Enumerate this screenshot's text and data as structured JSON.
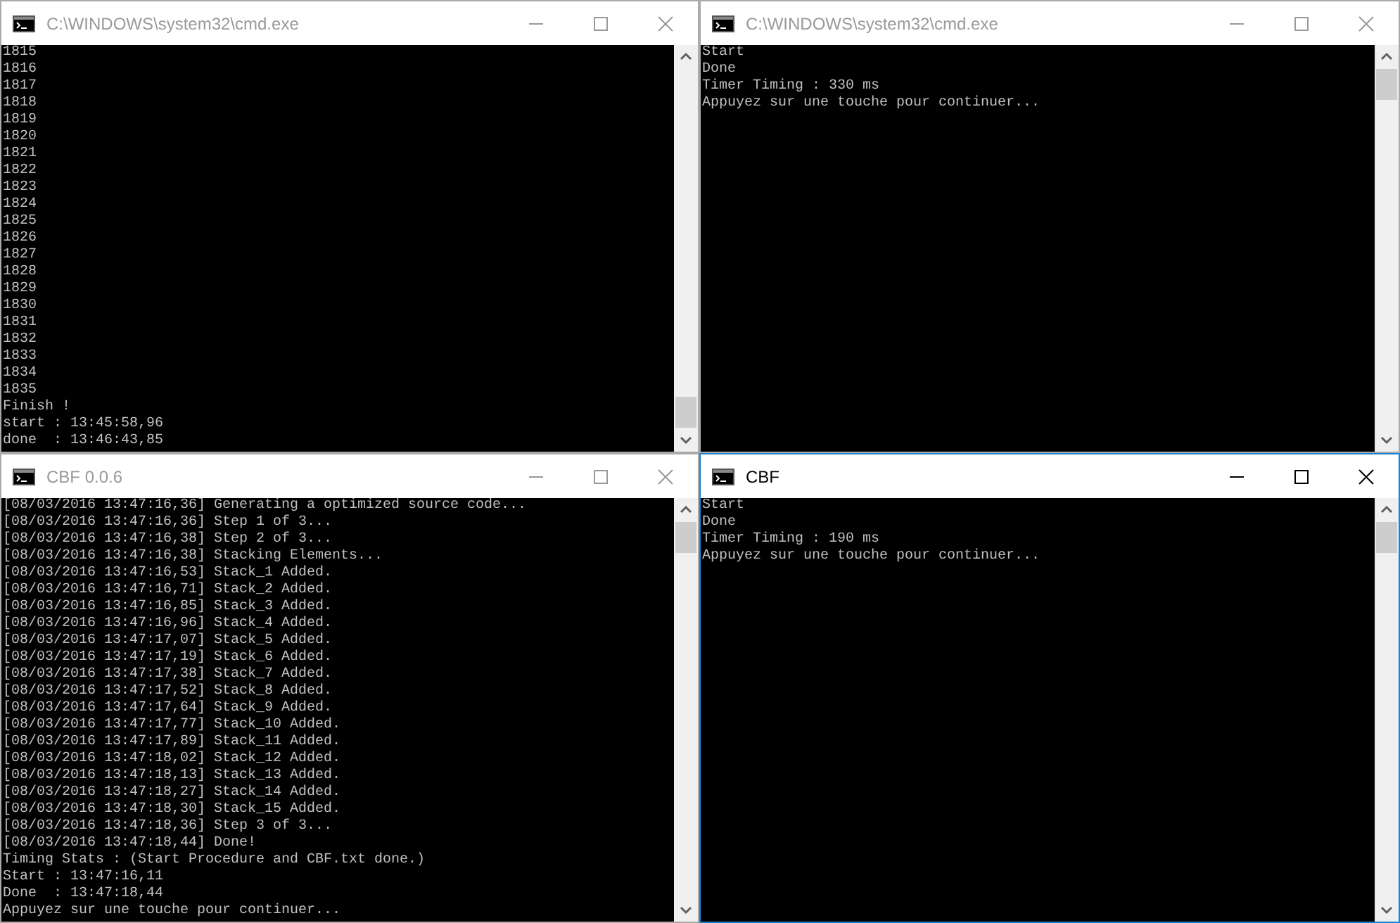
{
  "windows": [
    {
      "title": "C:\\WINDOWS\\system32\\cmd.exe",
      "active": false,
      "scrolled_to_bottom": true,
      "lines": [
        "1815",
        "1816",
        "1817",
        "1818",
        "1819",
        "1820",
        "1821",
        "1822",
        "1823",
        "1824",
        "1825",
        "1826",
        "1827",
        "1828",
        "1829",
        "1830",
        "1831",
        "1832",
        "1833",
        "1834",
        "1835",
        "Finish !",
        "start : 13:45:58,96",
        "done  : 13:46:43,85"
      ]
    },
    {
      "title": "C:\\WINDOWS\\system32\\cmd.exe",
      "active": false,
      "scrolled_to_bottom": false,
      "lines": [
        "Start",
        "Done",
        "Timer Timing : 330 ms",
        "Appuyez sur une touche pour continuer..."
      ]
    },
    {
      "title": "CBF 0.0.6",
      "active": false,
      "scrolled_to_bottom": false,
      "lines": [
        "[08/03/2016 13:47:16,36] Generating a optimized source code...",
        "[08/03/2016 13:47:16,36] Step 1 of 3...",
        "[08/03/2016 13:47:16,38] Step 2 of 3...",
        "[08/03/2016 13:47:16,38] Stacking Elements...",
        "[08/03/2016 13:47:16,53] Stack_1 Added.",
        "[08/03/2016 13:47:16,71] Stack_2 Added.",
        "[08/03/2016 13:47:16,85] Stack_3 Added.",
        "[08/03/2016 13:47:16,96] Stack_4 Added.",
        "[08/03/2016 13:47:17,07] Stack_5 Added.",
        "[08/03/2016 13:47:17,19] Stack_6 Added.",
        "[08/03/2016 13:47:17,38] Stack_7 Added.",
        "[08/03/2016 13:47:17,52] Stack_8 Added.",
        "[08/03/2016 13:47:17,64] Stack_9 Added.",
        "[08/03/2016 13:47:17,77] Stack_10 Added.",
        "[08/03/2016 13:47:17,89] Stack_11 Added.",
        "[08/03/2016 13:47:18,02] Stack_12 Added.",
        "[08/03/2016 13:47:18,13] Stack_13 Added.",
        "[08/03/2016 13:47:18,27] Stack_14 Added.",
        "[08/03/2016 13:47:18,30] Stack_15 Added.",
        "[08/03/2016 13:47:18,36] Step 3 of 3...",
        "[08/03/2016 13:47:18,44] Done!",
        "Timing Stats : (Start Procedure and CBF.txt done.)",
        "Start : 13:47:16,11",
        "Done  : 13:47:18,44",
        "Appuyez sur une touche pour continuer..."
      ]
    },
    {
      "title": "CBF",
      "active": true,
      "scrolled_to_bottom": false,
      "lines": [
        "Start",
        "Done",
        "Timer Timing : 190 ms",
        "Appuyez sur une touche pour continuer..."
      ]
    }
  ]
}
